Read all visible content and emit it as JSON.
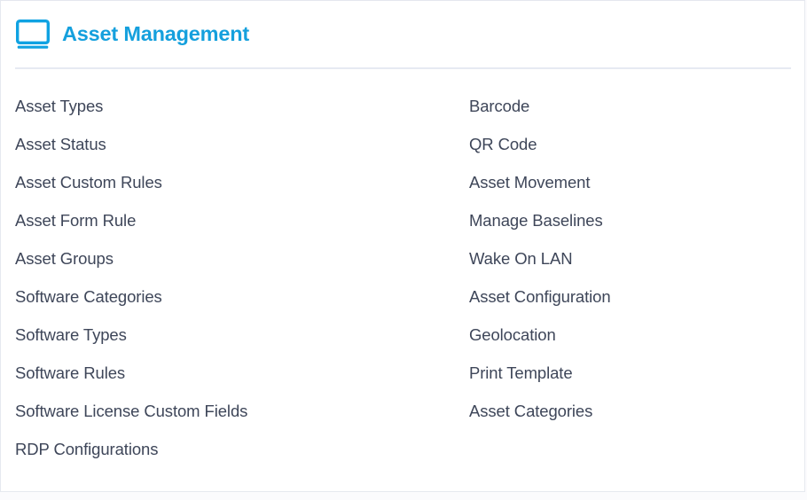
{
  "card": {
    "header": {
      "icon": "monitor-icon",
      "title": "Asset Management",
      "accent_color": "#15a0dd"
    },
    "link_color": "#3e4659",
    "divider_color": "#e6eaf2",
    "border_color": "#e6e9ef",
    "background_color": "#ffffff",
    "columns": [
      {
        "name": "left",
        "items": [
          {
            "label": "Asset Types"
          },
          {
            "label": "Asset Status"
          },
          {
            "label": "Asset Custom Rules"
          },
          {
            "label": "Asset Form Rule"
          },
          {
            "label": "Asset Groups"
          },
          {
            "label": "Software Categories"
          },
          {
            "label": "Software Types"
          },
          {
            "label": "Software Rules"
          },
          {
            "label": "Software License Custom Fields"
          },
          {
            "label": "RDP Configurations"
          }
        ]
      },
      {
        "name": "right",
        "items": [
          {
            "label": "Barcode"
          },
          {
            "label": "QR Code"
          },
          {
            "label": "Asset Movement"
          },
          {
            "label": "Manage Baselines"
          },
          {
            "label": "Wake On LAN"
          },
          {
            "label": "Asset Configuration"
          },
          {
            "label": "Geolocation"
          },
          {
            "label": "Print Template"
          },
          {
            "label": "Asset Categories"
          }
        ]
      }
    ]
  }
}
